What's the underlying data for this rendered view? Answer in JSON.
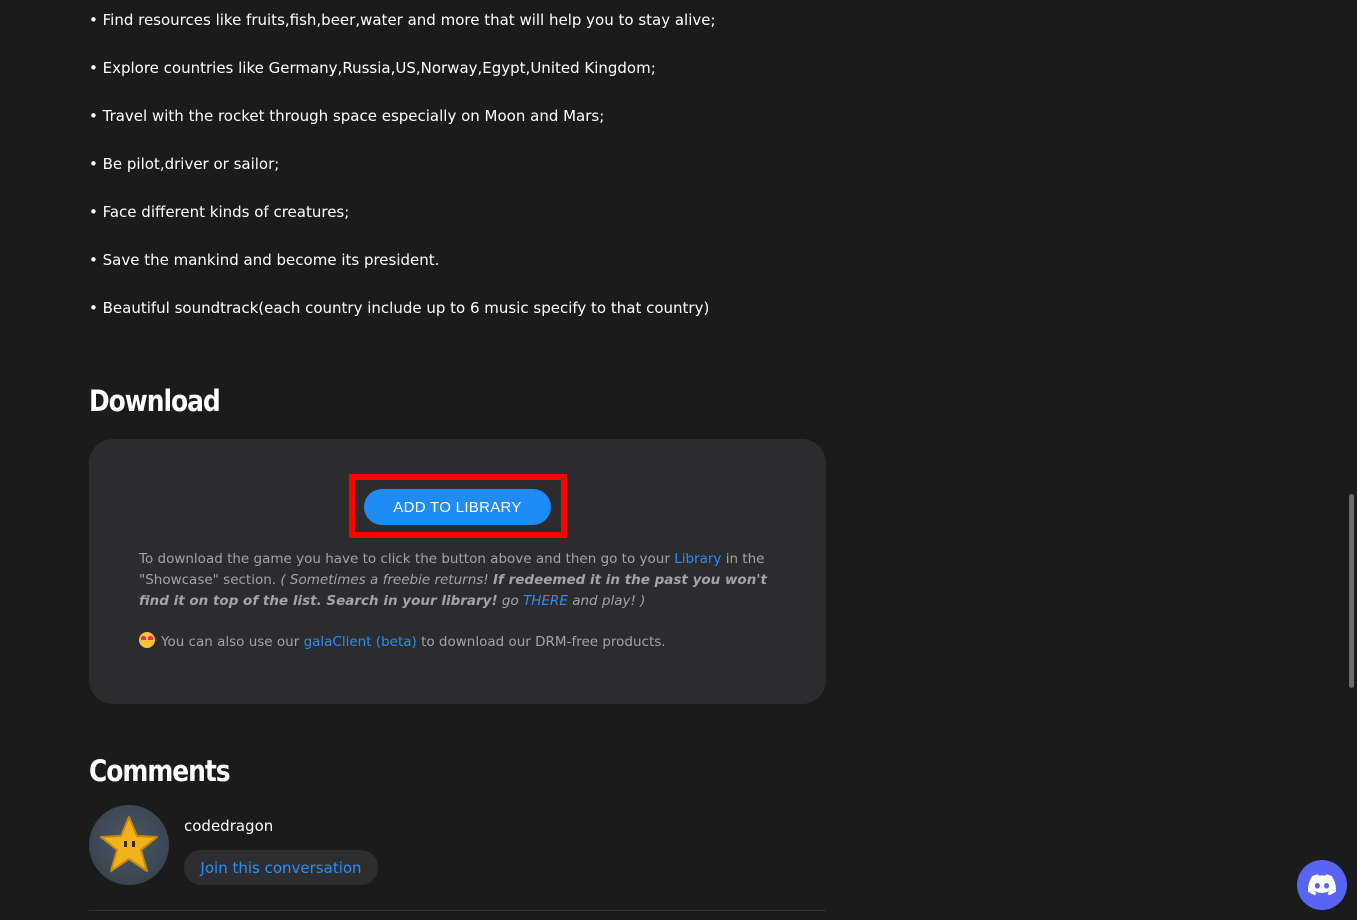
{
  "features": [
    "• Find resources like fruits,fish,beer,water and more that will help you to stay alive;",
    "• Explore countries like Germany,Russia,US,Norway,Egypt,United Kingdom;",
    "• Travel with the rocket through space especially on Moon and Mars;",
    "• Be pilot,driver or sailor;",
    "• Face different kinds of creatures;",
    "• Save the mankind and become its president.",
    "• Beautiful soundtrack(each country include up to 6 music specify to that country)"
  ],
  "download": {
    "title": "Download",
    "button_label": "ADD TO LIBRARY",
    "text_part1": "To download the game you have to click the button above and then go to your ",
    "library_link": "Library",
    "text_part2": " in the \"Showcase\" section. ",
    "italic_part1": "( Sometimes a freebie returns! ",
    "bold_italic_part": "If redeemed it in the past you won't find it on top of the list. Search in your library!",
    "italic_part2": " go ",
    "there_link": "THERE",
    "italic_part3": " and play! )",
    "client_text1": "You can also use our ",
    "client_link": "galaClient (beta)",
    "client_text2": " to download our DRM-free products.",
    "emoji_icon": "star-struck-emoji-icon"
  },
  "comments": {
    "title": "Comments",
    "author": "codedragon",
    "join_label": "Join this conversation"
  },
  "discord": {
    "icon": "discord-icon",
    "color": "#5865f2"
  },
  "colors": {
    "accent": "#1f8bf5",
    "highlight": "#ff0000",
    "background": "#1b1b1c",
    "card": "#2c2c2e"
  }
}
